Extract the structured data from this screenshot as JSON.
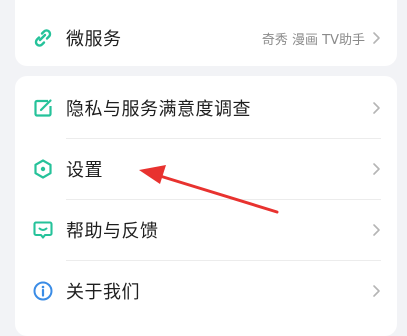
{
  "colors": {
    "accent": "#25c29a",
    "info": "#3a8ce6",
    "arrow": "#e8322f"
  },
  "top_card": {
    "micro_service": {
      "label": "微服务",
      "extra": "奇秀 漫画 TV助手",
      "icon": "link-icon"
    }
  },
  "menu": {
    "items": [
      {
        "label": "隐私与服务满意度调查",
        "icon": "survey-icon"
      },
      {
        "label": "设置",
        "icon": "settings-hex-icon"
      },
      {
        "label": "帮助与反馈",
        "icon": "chat-icon"
      },
      {
        "label": "关于我们",
        "icon": "info-icon"
      }
    ]
  }
}
